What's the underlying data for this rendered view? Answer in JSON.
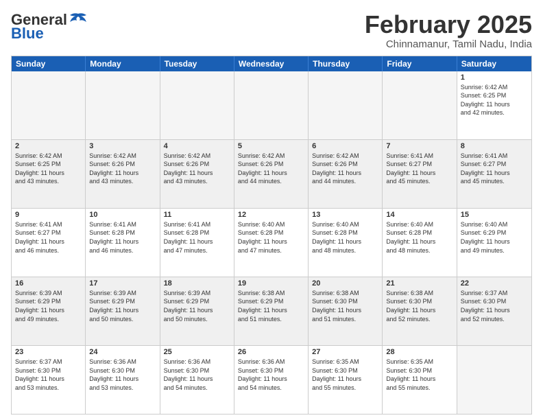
{
  "header": {
    "logo_general": "General",
    "logo_blue": "Blue",
    "title": "February 2025",
    "location": "Chinnamanur, Tamil Nadu, India"
  },
  "days_of_week": [
    "Sunday",
    "Monday",
    "Tuesday",
    "Wednesday",
    "Thursday",
    "Friday",
    "Saturday"
  ],
  "weeks": [
    {
      "cells": [
        {
          "day": "",
          "info": "",
          "empty": true
        },
        {
          "day": "",
          "info": "",
          "empty": true
        },
        {
          "day": "",
          "info": "",
          "empty": true
        },
        {
          "day": "",
          "info": "",
          "empty": true
        },
        {
          "day": "",
          "info": "",
          "empty": true
        },
        {
          "day": "",
          "info": "",
          "empty": true
        },
        {
          "day": "1",
          "info": "Sunrise: 6:42 AM\nSunset: 6:25 PM\nDaylight: 11 hours\nand 42 minutes.",
          "empty": false
        }
      ]
    },
    {
      "cells": [
        {
          "day": "2",
          "info": "Sunrise: 6:42 AM\nSunset: 6:25 PM\nDaylight: 11 hours\nand 43 minutes.",
          "empty": false
        },
        {
          "day": "3",
          "info": "Sunrise: 6:42 AM\nSunset: 6:26 PM\nDaylight: 11 hours\nand 43 minutes.",
          "empty": false
        },
        {
          "day": "4",
          "info": "Sunrise: 6:42 AM\nSunset: 6:26 PM\nDaylight: 11 hours\nand 43 minutes.",
          "empty": false
        },
        {
          "day": "5",
          "info": "Sunrise: 6:42 AM\nSunset: 6:26 PM\nDaylight: 11 hours\nand 44 minutes.",
          "empty": false
        },
        {
          "day": "6",
          "info": "Sunrise: 6:42 AM\nSunset: 6:26 PM\nDaylight: 11 hours\nand 44 minutes.",
          "empty": false
        },
        {
          "day": "7",
          "info": "Sunrise: 6:41 AM\nSunset: 6:27 PM\nDaylight: 11 hours\nand 45 minutes.",
          "empty": false
        },
        {
          "day": "8",
          "info": "Sunrise: 6:41 AM\nSunset: 6:27 PM\nDaylight: 11 hours\nand 45 minutes.",
          "empty": false
        }
      ]
    },
    {
      "cells": [
        {
          "day": "9",
          "info": "Sunrise: 6:41 AM\nSunset: 6:27 PM\nDaylight: 11 hours\nand 46 minutes.",
          "empty": false
        },
        {
          "day": "10",
          "info": "Sunrise: 6:41 AM\nSunset: 6:28 PM\nDaylight: 11 hours\nand 46 minutes.",
          "empty": false
        },
        {
          "day": "11",
          "info": "Sunrise: 6:41 AM\nSunset: 6:28 PM\nDaylight: 11 hours\nand 47 minutes.",
          "empty": false
        },
        {
          "day": "12",
          "info": "Sunrise: 6:40 AM\nSunset: 6:28 PM\nDaylight: 11 hours\nand 47 minutes.",
          "empty": false
        },
        {
          "day": "13",
          "info": "Sunrise: 6:40 AM\nSunset: 6:28 PM\nDaylight: 11 hours\nand 48 minutes.",
          "empty": false
        },
        {
          "day": "14",
          "info": "Sunrise: 6:40 AM\nSunset: 6:28 PM\nDaylight: 11 hours\nand 48 minutes.",
          "empty": false
        },
        {
          "day": "15",
          "info": "Sunrise: 6:40 AM\nSunset: 6:29 PM\nDaylight: 11 hours\nand 49 minutes.",
          "empty": false
        }
      ]
    },
    {
      "cells": [
        {
          "day": "16",
          "info": "Sunrise: 6:39 AM\nSunset: 6:29 PM\nDaylight: 11 hours\nand 49 minutes.",
          "empty": false
        },
        {
          "day": "17",
          "info": "Sunrise: 6:39 AM\nSunset: 6:29 PM\nDaylight: 11 hours\nand 50 minutes.",
          "empty": false
        },
        {
          "day": "18",
          "info": "Sunrise: 6:39 AM\nSunset: 6:29 PM\nDaylight: 11 hours\nand 50 minutes.",
          "empty": false
        },
        {
          "day": "19",
          "info": "Sunrise: 6:38 AM\nSunset: 6:29 PM\nDaylight: 11 hours\nand 51 minutes.",
          "empty": false
        },
        {
          "day": "20",
          "info": "Sunrise: 6:38 AM\nSunset: 6:30 PM\nDaylight: 11 hours\nand 51 minutes.",
          "empty": false
        },
        {
          "day": "21",
          "info": "Sunrise: 6:38 AM\nSunset: 6:30 PM\nDaylight: 11 hours\nand 52 minutes.",
          "empty": false
        },
        {
          "day": "22",
          "info": "Sunrise: 6:37 AM\nSunset: 6:30 PM\nDaylight: 11 hours\nand 52 minutes.",
          "empty": false
        }
      ]
    },
    {
      "cells": [
        {
          "day": "23",
          "info": "Sunrise: 6:37 AM\nSunset: 6:30 PM\nDaylight: 11 hours\nand 53 minutes.",
          "empty": false
        },
        {
          "day": "24",
          "info": "Sunrise: 6:36 AM\nSunset: 6:30 PM\nDaylight: 11 hours\nand 53 minutes.",
          "empty": false
        },
        {
          "day": "25",
          "info": "Sunrise: 6:36 AM\nSunset: 6:30 PM\nDaylight: 11 hours\nand 54 minutes.",
          "empty": false
        },
        {
          "day": "26",
          "info": "Sunrise: 6:36 AM\nSunset: 6:30 PM\nDaylight: 11 hours\nand 54 minutes.",
          "empty": false
        },
        {
          "day": "27",
          "info": "Sunrise: 6:35 AM\nSunset: 6:30 PM\nDaylight: 11 hours\nand 55 minutes.",
          "empty": false
        },
        {
          "day": "28",
          "info": "Sunrise: 6:35 AM\nSunset: 6:30 PM\nDaylight: 11 hours\nand 55 minutes.",
          "empty": false
        },
        {
          "day": "",
          "info": "",
          "empty": true
        }
      ]
    }
  ]
}
